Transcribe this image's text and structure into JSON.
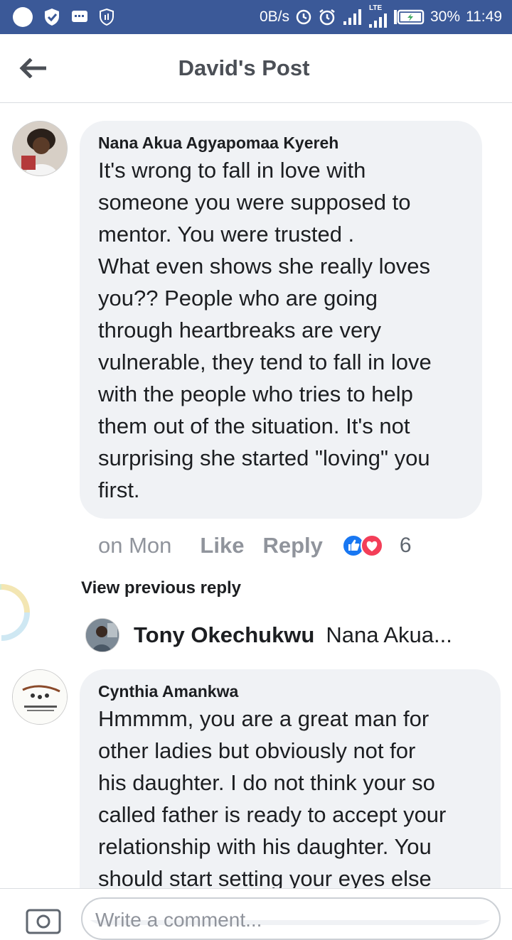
{
  "status_bar": {
    "network_speed": "0B/s",
    "signal_label": "LTE",
    "battery": "30%",
    "time": "11:49"
  },
  "header": {
    "title": "David's Post"
  },
  "comments": [
    {
      "author": "Nana Akua Agyapomaa Kyereh",
      "text_lines": [
        "It's wrong to fall in love with",
        "someone you were supposed to",
        "mentor. You were trusted .",
        "What even shows she really loves",
        "you?? People who are going",
        "through heartbreaks are very",
        "vulnerable, they tend to fall in love",
        "with the people who tries to help",
        "them out of the situation. It's not",
        "surprising she started \"loving\" you",
        "first."
      ],
      "time": "on Mon",
      "like_label": "Like",
      "reply_label": "Reply",
      "reaction_count": "6"
    },
    {
      "author": "Cynthia Amankwa",
      "text_lines": [
        "Hmmmm, you are a great man for",
        "other ladies but obviously not for",
        "his daughter.  I do not think your so",
        "called father is ready to accept your",
        "relationship with his daughter.  You",
        "should start setting your eyes else"
      ]
    }
  ],
  "view_previous_reply": "View previous reply",
  "reply_preview": {
    "name": "Tony Okechukwu",
    "text": "Nana Akua..."
  },
  "composer": {
    "placeholder": "Write a comment..."
  },
  "colors": {
    "status_bar": "#3b5998",
    "like_blue": "#1877f2",
    "love_red": "#f33e58"
  }
}
